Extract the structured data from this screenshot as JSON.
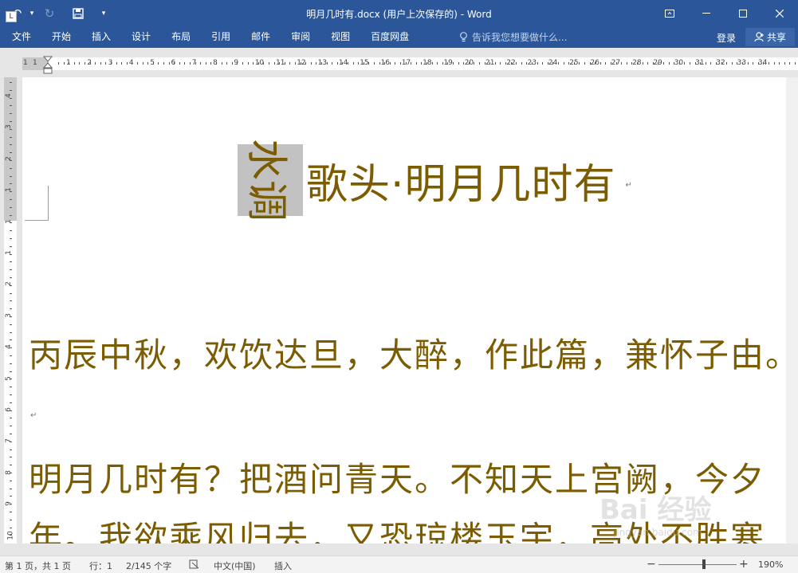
{
  "app": {
    "title": "明月几时有.docx (用户上次保存的) - Word"
  },
  "qat": {
    "undo_icon": "undo-icon",
    "redo_icon": "redo-icon",
    "save_icon": "save-icon",
    "customize_icon": "customize-qat-icon"
  },
  "ribbon": {
    "tabs": [
      "文件",
      "开始",
      "插入",
      "设计",
      "布局",
      "引用",
      "邮件",
      "审阅",
      "视图",
      "百度网盘"
    ],
    "tell_me": "告诉我您想要做什么...",
    "login": "登录",
    "share": "共享"
  },
  "ruler": {
    "h_labels": [
      "1",
      "1",
      "1",
      "2",
      "3",
      "4",
      "5",
      "6",
      "7",
      "8",
      "9",
      "10",
      "11",
      "12",
      "13",
      "14",
      "15",
      "16",
      "17",
      "18",
      "19",
      "20",
      "21",
      "22",
      "23",
      "24",
      "25",
      "26",
      "27",
      "28",
      "29",
      "30",
      "31",
      "32",
      "33",
      "34"
    ],
    "v_labels": [
      "4",
      "3",
      "2",
      "1",
      "1",
      "1",
      "2",
      "3",
      "4",
      "5",
      "6",
      "7",
      "8",
      "9",
      "10"
    ],
    "tab_selector": "L"
  },
  "document": {
    "title_selected": "水调",
    "title_rest": "歌头·明月几时有",
    "line1": "丙辰中秋，欢饮达旦，大醉，作此篇，兼怀子由。",
    "line2": "明月几时有？把酒问青天。不知天上宫阙，今夕",
    "line3": "年。我欲乘风归去，又恐琼楼玉宇，高处不胜寒",
    "paragraph_mark": "↵"
  },
  "status": {
    "page": "第 1 页，共 1 页",
    "line": "行：1",
    "words": "2/145 个字",
    "language": "中文(中国)",
    "mode": "插入",
    "zoom": "190%"
  },
  "watermark": {
    "brand": "Bai 经验",
    "url": "jingyan.baidu.com"
  },
  "colors": {
    "title_bar": "#2b579a",
    "text": "#7c5c00",
    "selection": "#c2c2c2"
  }
}
